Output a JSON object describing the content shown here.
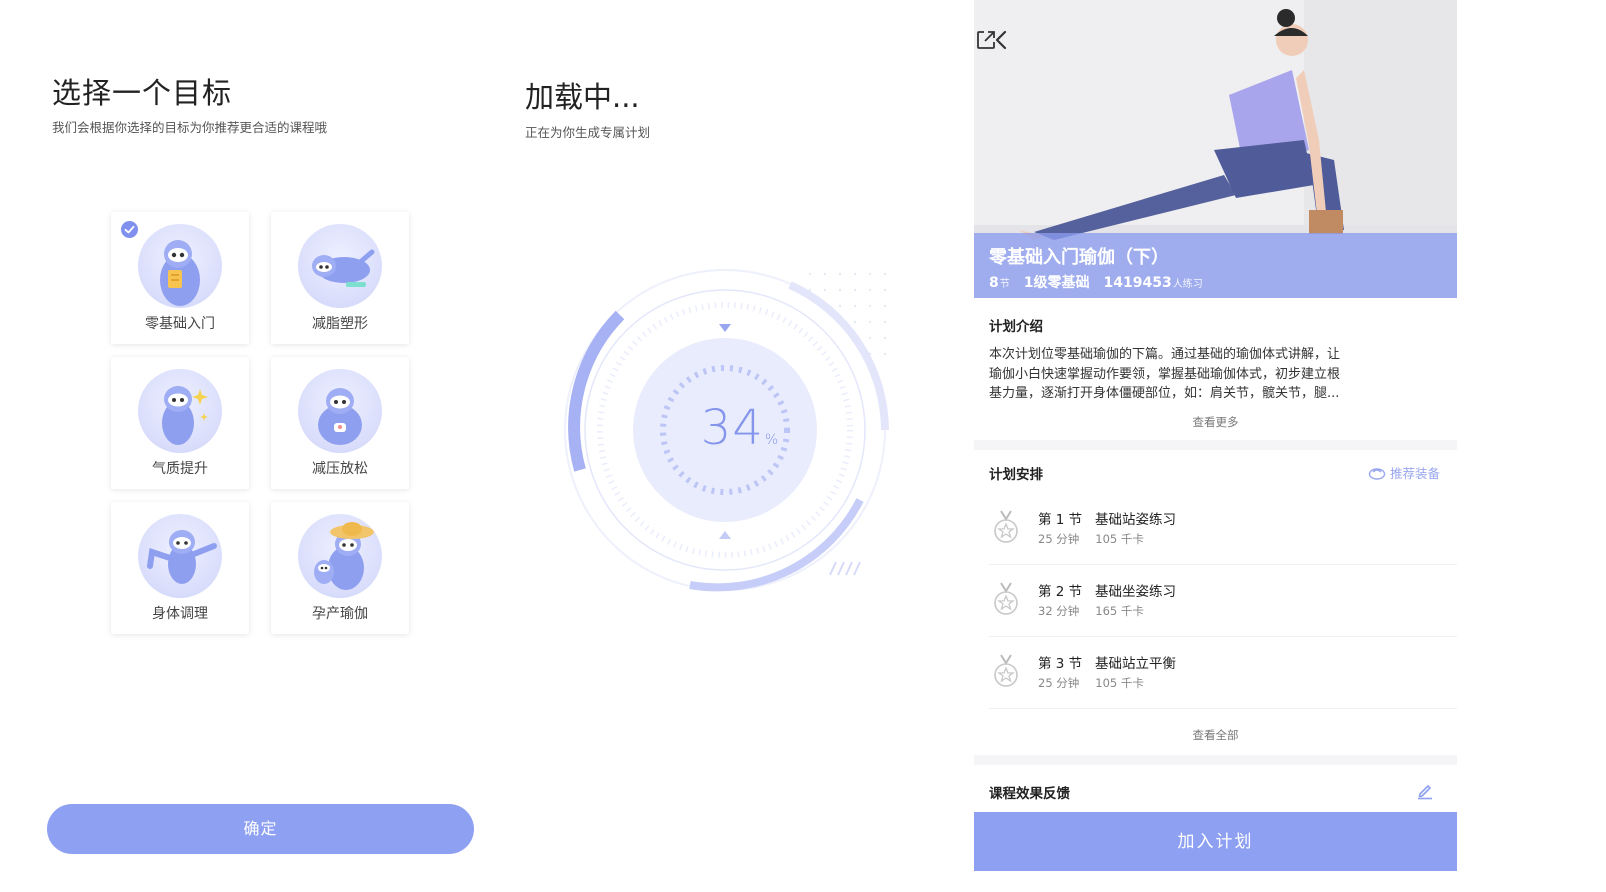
{
  "goal_screen": {
    "title": "选择一个目标",
    "subtitle": "我们会根据你选择的目标为你推荐更合适的课程哦",
    "goals": [
      {
        "label": "零基础入门",
        "selected": true,
        "icon": "sloth-reading-icon"
      },
      {
        "label": "减脂塑形",
        "selected": false,
        "icon": "sloth-stretching-icon"
      },
      {
        "label": "气质提升",
        "selected": false,
        "icon": "sloth-sparkle-icon"
      },
      {
        "label": "减压放松",
        "selected": false,
        "icon": "sloth-relax-icon"
      },
      {
        "label": "身体调理",
        "selected": false,
        "icon": "sloth-pose-icon"
      },
      {
        "label": "孕产瑜伽",
        "selected": false,
        "icon": "sloth-family-icon"
      }
    ],
    "confirm_label": "确定"
  },
  "loading_screen": {
    "title": "加载中...",
    "subtitle": "正在为你生成专属计划",
    "progress_value": "34",
    "progress_unit": "%"
  },
  "course_screen": {
    "course_title": "零基础入门瑜伽（下）",
    "sessions_count": "8",
    "sessions_unit": "节",
    "level": "1级零基础",
    "participants": "1419453",
    "participants_unit": "人练习",
    "intro_heading": "计划介绍",
    "intro_lines": [
      "本次计划位零基础瑜伽的下篇。通过基础的瑜伽体式讲解，让",
      "瑜伽小白快速掌握动作要领，掌握基础瑜伽体式，初步建立根",
      "基力量，逐渐打开身体僵硬部位，如：肩关节，髋关节，腿..."
    ],
    "see_more_label": "查看更多",
    "schedule_heading": "计划安排",
    "recommend_label": "推荐装备",
    "lessons": [
      {
        "index": "第 1 节",
        "name": "基础站姿练习",
        "duration": "25 分钟",
        "calories": "105 千卡"
      },
      {
        "index": "第 2 节",
        "name": "基础坐姿练习",
        "duration": "32 分钟",
        "calories": "165 千卡"
      },
      {
        "index": "第 3 节",
        "name": "基础站立平衡",
        "duration": "25 分钟",
        "calories": "105 千卡"
      }
    ],
    "see_all_label": "查看全部",
    "feedback_heading": "课程效果反馈",
    "join_label": "加入计划"
  },
  "colors": {
    "accent": "#8ea0f2",
    "accent_text": "#8495ec",
    "ring_light": "#dfe3fb"
  }
}
